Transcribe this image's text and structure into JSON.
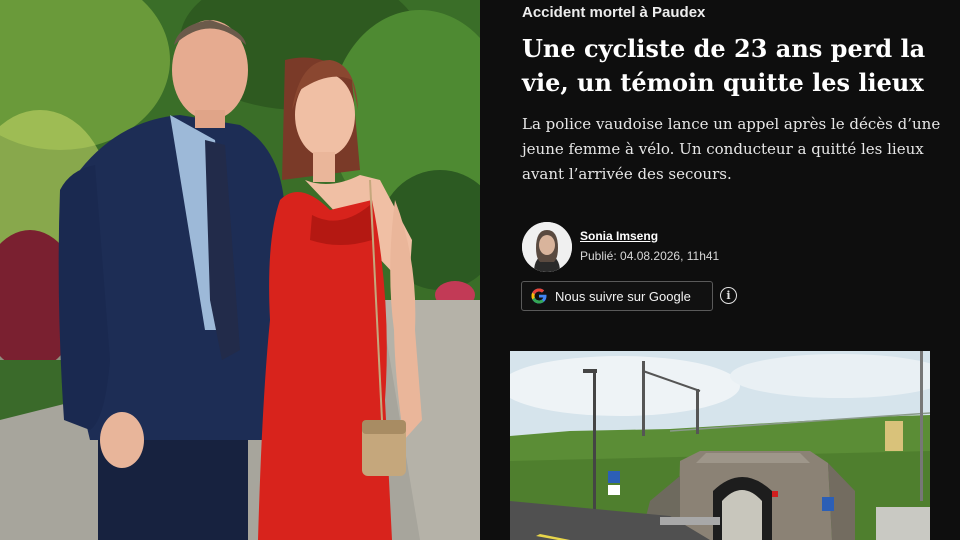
{
  "article": {
    "kicker": "Accident mortel à Paudex",
    "headline": "Une cycliste de 23 ans perd la vie, un témoin quitte les lieux",
    "lead": "La police vaudoise lance un appel après le décès d’une jeune femme à vélo. Un conducteur a quitté les lieux avant l’arrivée des secours.",
    "author": {
      "name": "Sonia Imseng",
      "published": "Publié: 04.08.2026, 11h41"
    },
    "follow_button_label": "Nous suivre sur Google",
    "icons": {
      "google": "google-logo-icon",
      "info": "info-icon"
    }
  },
  "colors": {
    "article_background": "#0e0e0e",
    "dress_red": "#d8231c",
    "suit_navy": "#1d2d55",
    "foliage_green": "#3d7a2c"
  }
}
